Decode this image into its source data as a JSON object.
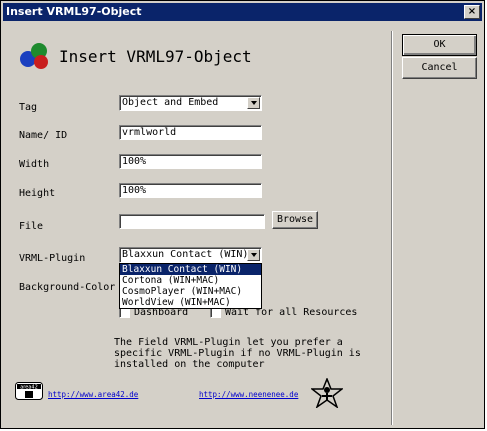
{
  "window": {
    "title": "Insert VRML97-Object",
    "close_glyph": "×"
  },
  "header": {
    "title": "Insert VRML97-Object",
    "logo_icon": "vrml-molecule-logo"
  },
  "buttons": {
    "ok": "OK",
    "cancel": "Cancel",
    "browse": "Browse"
  },
  "form": {
    "tag_label": "Tag",
    "tag_value": "Object and Embed",
    "name_label": "Name/ ID",
    "name_value": "vrmlworld",
    "width_label": "Width",
    "width_value": "100%",
    "height_label": "Height",
    "height_value": "100%",
    "file_label": "File",
    "file_value": "",
    "plugin_label": "VRML-Plugin",
    "plugin_value": "Blaxxun Contact (WIN)",
    "plugin_options": [
      "Blaxxun Contact (WIN)",
      "Cortona (WIN+MAC)",
      "CosmoPlayer (WIN+MAC)",
      "WorldView (WIN+MAC)"
    ],
    "bgcolor_label": "Background-Color",
    "dashboard_label": "Dashboard",
    "wait_label": "Wait for all Resources"
  },
  "note": "The Field VRML-Plugin let you prefer a\nspecific VRML-Plugin if no VRML-Plugin is\ninstalled on the computer",
  "footer": {
    "link1": "http://www.area42.de",
    "link2": "http://www.neenenee.de",
    "area42_icon": "area42-logo",
    "neenenee_icon": "star-figure-logo"
  },
  "colors": {
    "titlebar": "#0a246a",
    "dialog_bg": "#d4d0c8",
    "link": "#0000cc"
  }
}
